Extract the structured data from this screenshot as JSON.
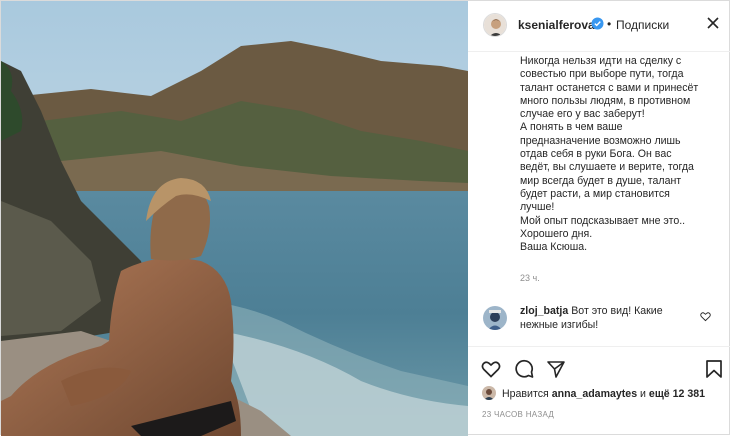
{
  "header": {
    "username": "ksenialferova",
    "separator": "•",
    "follow_label": "Подписки"
  },
  "caption": {
    "lines": [
      "Никогда нельзя идти на сделку с",
      "совестью при выборе пути, тогда",
      "талант останется с вами и принесёт",
      "много пользы людям, в противном",
      "случае его у вас заберут!",
      "А понять в чем ваше",
      "предназначение возможно лишь",
      "отдав себя в руки Бога. Он вас",
      "ведёт, вы слушаете и верите, тогда",
      "мир всегда будет в душе, талант",
      "будет расти, а мир становится",
      "лучше!",
      "Мой опыт подсказывает мне это..",
      "Хорошего дня.",
      "Ваша Ксюша."
    ],
    "time": "23 ч."
  },
  "comment": {
    "username": "zloj_batja",
    "line1": "Вот это вид! Какие",
    "line2": "нежные изгибы!"
  },
  "likes": {
    "prefix": "Нравится",
    "user": "anna_adamaytes",
    "middle": "и",
    "rest": "ещё 12 381"
  },
  "timestamp": "23 ЧАСОВ НАЗАД",
  "icons": {
    "verified": "verified-badge-icon",
    "more": "more-options-icon",
    "like": "heart-icon",
    "comment": "comment-icon",
    "share": "paper-plane-icon",
    "save": "bookmark-icon"
  },
  "colors": {
    "verified": "#3897f0",
    "muted": "#8e8e8e",
    "text": "#262626",
    "border": "#dbdbdb"
  }
}
